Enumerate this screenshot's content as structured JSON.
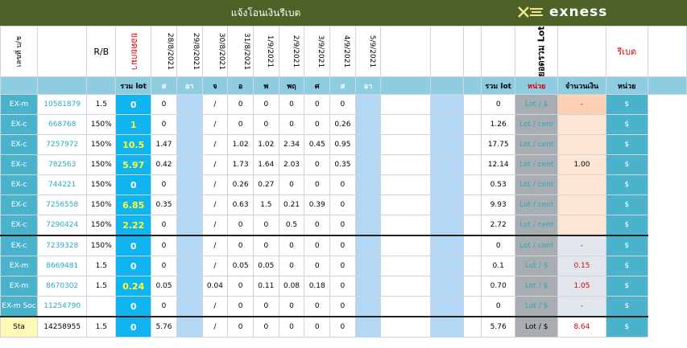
{
  "header": {
    "title": "แจ้งโอนเงินรีเบต",
    "brand": "exness"
  },
  "columns": {
    "broker_label": "เลขที่ บ/ช",
    "rb": "R/B",
    "balance_label": "ยอดยกมา",
    "dates": [
      "28/8/2021",
      "29/8/2021",
      "30/8/2021",
      "31/8/2021",
      "1/9/2021",
      "2/9/2021",
      "3/9/2021",
      "4/9/2021",
      "5/9/2021"
    ],
    "total_lot_label": "ยอดรวม Lot",
    "rebate_label": "รีเบต",
    "sum_lot": "รวม lot",
    "days": [
      "ส",
      "อา",
      "จ",
      "อ",
      "พ",
      "พฤ",
      "ศ",
      "ส",
      "อา"
    ],
    "sum_lot2": "รวม lot",
    "unit": "หน่วย",
    "amount": "จำนวนเงิน",
    "unit2": "หน่วย"
  },
  "rows": [
    {
      "type": "EX-m",
      "acct": "10581879",
      "rb": "1.5",
      "sum": "0",
      "d": [
        "0",
        "",
        "/",
        "0",
        "0",
        "0",
        "0",
        "0",
        ""
      ],
      "total": "0",
      "unit": "Lot / $",
      "amount": "-",
      "cur": "$"
    },
    {
      "type": "EX-c",
      "acct": "668768",
      "rb": "150%",
      "sum": "1",
      "d": [
        "0",
        "",
        "/",
        "0",
        "0",
        "0",
        "0",
        "0.26",
        ""
      ],
      "total": "1.26",
      "unit": "Lot / cent",
      "amount": "",
      "cur": "$"
    },
    {
      "type": "EX-c",
      "acct": "7257972",
      "rb": "150%",
      "sum": "10.5",
      "d": [
        "1.47",
        "",
        "/",
        "1.02",
        "1.02",
        "2.34",
        "0.45",
        "0.95",
        ""
      ],
      "total": "17.75",
      "unit": "Lot / cent",
      "amount": "",
      "cur": "$"
    },
    {
      "type": "EX-c",
      "acct": "782563",
      "rb": "150%",
      "sum": "5.97",
      "d": [
        "0.42",
        "",
        "/",
        "1.73",
        "1.64",
        "2.03",
        "0",
        "0.35",
        ""
      ],
      "total": "12.14",
      "unit": "Lot / cent",
      "amount": "1.00",
      "cur": "$"
    },
    {
      "type": "EX-c",
      "acct": "744221",
      "rb": "150%",
      "sum": "0",
      "d": [
        "0",
        "",
        "/",
        "0.26",
        "0.27",
        "0",
        "0",
        "0",
        ""
      ],
      "total": "0.53",
      "unit": "Lot / cent",
      "amount": "",
      "cur": "$"
    },
    {
      "type": "EX-c",
      "acct": "7256558",
      "rb": "150%",
      "sum": "6.85",
      "d": [
        "0.35",
        "",
        "/",
        "0.63",
        "1.5",
        "0.21",
        "0.39",
        "0",
        ""
      ],
      "total": "9.93",
      "unit": "Lot / cent",
      "amount": "",
      "cur": "$"
    },
    {
      "type": "EX-c",
      "acct": "7290424",
      "rb": "150%",
      "sum": "2.22",
      "d": [
        "0",
        "",
        "/",
        "0",
        "0",
        "0.5",
        "0",
        "0",
        ""
      ],
      "total": "2.72",
      "unit": "Lot / cent",
      "amount": "",
      "cur": "$"
    },
    {
      "type": "EX-c",
      "acct": "7239328",
      "rb": "150%",
      "sum": "0",
      "d": [
        "0",
        "",
        "/",
        "0",
        "0",
        "0",
        "0",
        "0",
        ""
      ],
      "total": "0",
      "unit": "Lot / cent",
      "amount": "-",
      "cur": "$"
    },
    {
      "type": "EX-m",
      "acct": "8669481",
      "rb": "1.5",
      "sum": "0",
      "d": [
        "0",
        "",
        "/",
        "0.05",
        "0.05",
        "0",
        "0",
        "0",
        ""
      ],
      "total": "0.1",
      "unit": "Lot / $",
      "amount": "0.15",
      "cur": "$"
    },
    {
      "type": "EX-m",
      "acct": "8670302",
      "rb": "1.5",
      "sum": "0.24",
      "d": [
        "0.05",
        "",
        "0.04",
        "0",
        "0.11",
        "0.08",
        "0.18",
        "0",
        ""
      ],
      "total": "0.70",
      "unit": "Lot / $",
      "amount": "1.05",
      "cur": "$"
    },
    {
      "type": "EX-m Soc",
      "acct": "11254790",
      "rb": "",
      "sum": "0",
      "d": [
        "0",
        "",
        "/",
        "0",
        "0",
        "0",
        "0",
        "0",
        ""
      ],
      "total": "0",
      "unit": "Lot / $",
      "amount": "-",
      "cur": "$"
    },
    {
      "type": "Sta",
      "acct": "14258955",
      "rb": "1.5",
      "sum": "0",
      "d": [
        "5.76",
        "",
        "/",
        "0",
        "0",
        "0",
        "0",
        "0",
        ""
      ],
      "total": "5.76",
      "unit": "Lot / $",
      "amount": "8.64",
      "cur": "$"
    }
  ]
}
